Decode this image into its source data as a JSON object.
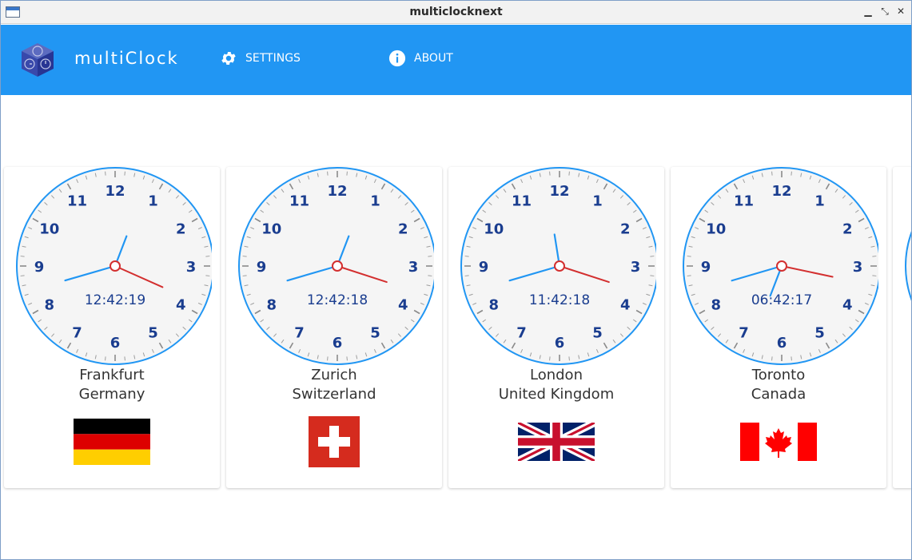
{
  "window": {
    "title": "multiclocknext"
  },
  "appbar": {
    "app_name": "multiClock",
    "settings_label": "SETTINGS",
    "about_label": "ABOUT",
    "color": "#2196f3"
  },
  "clocks": [
    {
      "city": "Frankfurt",
      "country": "Germany",
      "time": "12:42:19",
      "flag": "germany-flag-icon"
    },
    {
      "city": "Zurich",
      "country": "Switzerland",
      "time": "12:42:18",
      "flag": "switzerland-flag-icon"
    },
    {
      "city": "London",
      "country": "United Kingdom",
      "time": "11:42:18",
      "flag": "uk-flag-icon"
    },
    {
      "city": "Toronto",
      "country": "Canada",
      "time": "06:42:17",
      "flag": "canada-flag-icon"
    }
  ],
  "dial_numbers": [
    "12",
    "1",
    "2",
    "3",
    "4",
    "5",
    "6",
    "7",
    "8",
    "9",
    "10",
    "11"
  ],
  "colors": {
    "dial_ring": "#2196f3",
    "numbers": "#1a3d8f",
    "second_hand": "#d32f2f",
    "hour_minute_hand": "#2196f3"
  }
}
